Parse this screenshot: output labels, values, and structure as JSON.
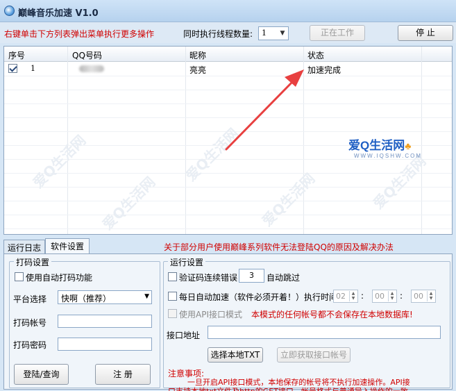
{
  "window": {
    "title": "巅峰音乐加速 V1.0"
  },
  "toolbar": {
    "hint": "右键单击下方列表弹出菜单执行更多操作",
    "threads_label": "同时执行线程数量:",
    "threads_value": "1",
    "working_button": "正在工作",
    "stop_button": "停    止"
  },
  "grid": {
    "columns": [
      "序号",
      "QQ号码",
      "昵称",
      "状态"
    ],
    "rows": [
      {
        "index": "1",
        "qq": "",
        "nickname": "亮亮",
        "status": "加速完成",
        "checked": true
      }
    ]
  },
  "watermark": {
    "logo": "爱Q生活网",
    "url": "WWW.IQSHW.COM",
    "tile": "爱Q生活网"
  },
  "tabs": {
    "items": [
      "运行日志",
      "软件设置"
    ],
    "active": 1
  },
  "notice_link": "关于部分用户使用巅峰系列软件无法登陆QQ的原因及解决办法",
  "captcha": {
    "legend": "打码设置",
    "auto_captcha": "使用自动打码功能",
    "platform_label": "平台选择",
    "platform_value": "快啊（推荐）",
    "account_label": "打码帐号",
    "password_label": "打码密码",
    "login_button": "登陆/查询",
    "register_button": "注    册"
  },
  "run": {
    "legend": "运行设置",
    "captcha_error_prefix": "验证码连续错误",
    "captcha_error_count": "3",
    "captcha_error_suffix": "自动跳过",
    "daily_label": "每日自动加速（软件必须开着！）执行时间",
    "time_h": "02",
    "time_m": "00",
    "time_s": "00",
    "colon": ":",
    "api_mode": "使用API接口模式",
    "api_warning": "本模式的任何帐号都不会保存在本地数据库!",
    "api_addr_label": "接口地址",
    "select_txt_button": "选择本地TXT",
    "fetch_api_button": "立即获取接口帐号",
    "notes_title": "注意事项:",
    "notes_line1": "一旦开启API接口模式，本地保存的帐号将不执行加速操作。API接",
    "notes_line2": "口支持本地txt文件及http的GET接口，帐号格式与普通导入操作的一致。"
  },
  "colors": {
    "red": "#d00000",
    "title_bg": "#b6d2ee",
    "arrow": "#e84040"
  }
}
